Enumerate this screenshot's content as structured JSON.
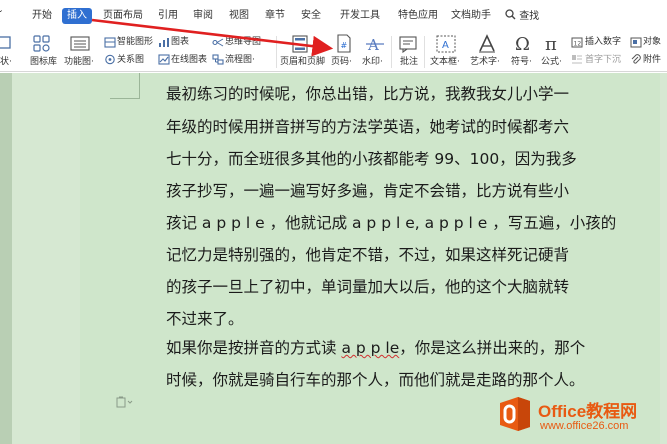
{
  "menu": {
    "tabs": [
      {
        "label": "开始"
      },
      {
        "label": "插入"
      },
      {
        "label": "页面布局"
      },
      {
        "label": "引用"
      },
      {
        "label": "审阅"
      },
      {
        "label": "视图"
      },
      {
        "label": "章节"
      },
      {
        "label": "安全"
      },
      {
        "label": "开发工具"
      },
      {
        "label": "特色应用"
      },
      {
        "label": "文档助手"
      }
    ],
    "search_label": "查找",
    "partial_left": "ˇ"
  },
  "ribbon": {
    "shape_partial": "状·",
    "icon_lib": "图标库",
    "func_chart": "功能图·",
    "smart_shape": "智能图形",
    "relation": "关系图",
    "chart": "图表",
    "online_chart": "在线图表",
    "mindmap": "思维导图·",
    "flowchart": "流程图·",
    "header_footer": "页眉和页脚",
    "page_number": "页码·",
    "watermark": "水印·",
    "comment": "批注",
    "textbox": "文本框·",
    "wordart": "艺术字·",
    "symbol": "符号·",
    "formula": "公式·",
    "insert_number": "插入数字",
    "drop_cap": "首字下沉",
    "object": "对象",
    "attachment": "附件"
  },
  "document": {
    "lines": [
      "最初练习的时候呢，你总出错，比方说，我教我女儿小学一",
      "年级的时候用拼音拼写的方法学英语，她考试的时候都考六",
      "七十分，而全班很多其他的小孩都能考 99、100，因为我多",
      "孩子抄写，一遍一遍写好多遍，肯定不会错，比方说有些小",
      "孩记 a p p l e ，他就记成 a p p l e, a p p l e ，写五遍，小孩的",
      "记忆力是特别强的，他肯定不错，不过，如果这样死记硬背",
      "的孩子一旦上了初中，单词量加大以后，他的这个大脑就转",
      "不过来了。"
    ],
    "line9_a": "如果你是按拼音的方式读 ",
    "line9_b": "a p p le",
    "line9_c": "，你是这么拼出来的，那个",
    "line10": "时候，你就是骑自行车的那个人，而他们就是走路的那个人。"
  },
  "watermark": {
    "title": "Office教程网",
    "url": "www.office26.com"
  },
  "colors": {
    "accent": "#2f6fd1",
    "page_bg": "#cfe6cb",
    "arrow": "#e02020",
    "brand": "#e85a12"
  }
}
